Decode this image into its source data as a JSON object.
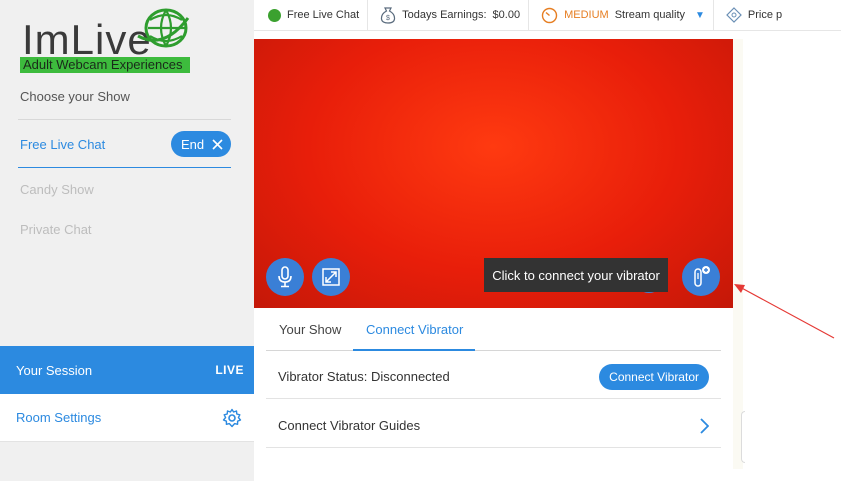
{
  "logo": {
    "wordmark": "ImLive",
    "tagline": "Adult Webcam Experiences"
  },
  "sidebar": {
    "choose_label": "Choose your Show",
    "shows": [
      {
        "label": "Free Live Chat",
        "active": true
      },
      {
        "label": "Candy Show",
        "active": false
      },
      {
        "label": "Private Chat",
        "active": false
      }
    ],
    "end_label": "End",
    "session_label": "Your Session",
    "live_badge": "LIVE",
    "room_settings_label": "Room Settings"
  },
  "topbar": {
    "chat_mode": "Free Live Chat",
    "earnings_label": "Todays Earnings:",
    "earnings_value": "$0.00",
    "quality_level": "MEDIUM",
    "quality_label": "Stream quality",
    "price_label": "Price p"
  },
  "video": {
    "tooltip": "Click to connect your vibrator"
  },
  "panel": {
    "tabs": [
      {
        "label": "Your Show",
        "active": false
      },
      {
        "label": "Connect Vibrator",
        "active": true
      }
    ],
    "status_label": "Vibrator Status: Disconnected",
    "connect_button": "Connect Vibrator",
    "guides_label": "Connect Vibrator Guides"
  },
  "colors": {
    "accent": "#2c8ae0",
    "live_green": "#3ba12f",
    "medium_orange": "#e67e22",
    "video_red": "#e81e0a",
    "annotation_red": "#e53935"
  },
  "icons": [
    "globe-logo-icon",
    "close-icon",
    "gear-icon",
    "money-bag-icon",
    "gauge-icon",
    "price-tag-icon",
    "caret-down-icon",
    "microphone-icon",
    "fullscreen-icon",
    "vibrator-add-icon",
    "chevron-right-icon"
  ]
}
